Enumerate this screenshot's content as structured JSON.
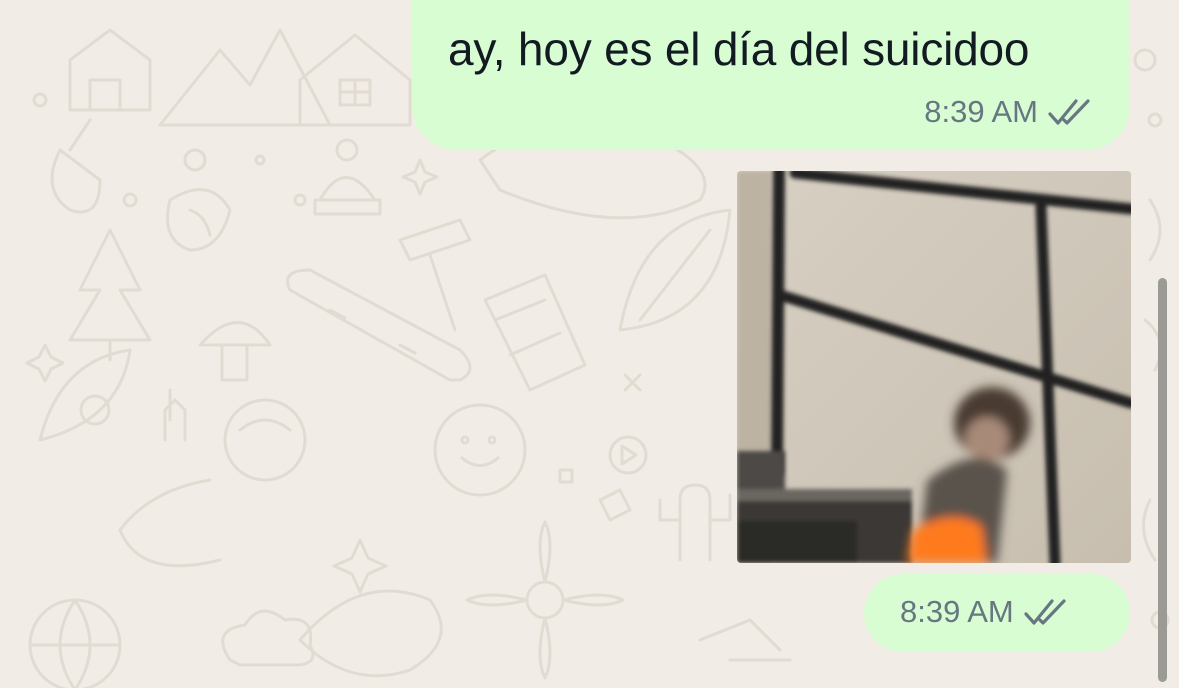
{
  "chat": {
    "background_color": "#f1ede6",
    "bubble_color": "#d9fdd3"
  },
  "messages": [
    {
      "type": "text",
      "text": "ay, hoy es el día del suicidoo",
      "time": "8:39 AM",
      "status_icon": "double-check-icon"
    },
    {
      "type": "media",
      "media_icon": "video-thumbnail",
      "time": "8:39 AM",
      "status_icon": "double-check-icon"
    }
  ]
}
